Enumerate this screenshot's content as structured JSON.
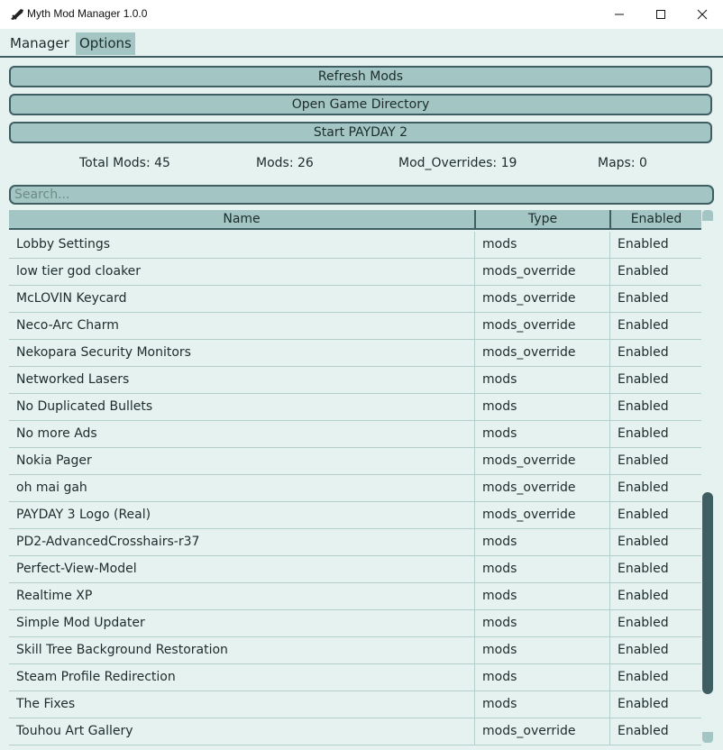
{
  "window": {
    "title": "Myth Mod Manager 1.0.0",
    "icons": {
      "app": "dagger-icon",
      "minimize": "minimize-icon",
      "maximize": "maximize-icon",
      "close": "close-icon"
    }
  },
  "menu": {
    "items": [
      {
        "label": "Manager"
      },
      {
        "label": "Options"
      }
    ],
    "active": "Options"
  },
  "actions": {
    "refresh": "Refresh Mods",
    "open_dir": "Open Game Directory",
    "start": "Start PAYDAY 2"
  },
  "stats": {
    "total": "Total Mods: 45",
    "mods": "Mods: 26",
    "overrides": "Mod_Overrides: 19",
    "maps": "Maps: 0"
  },
  "search": {
    "placeholder": "Search..."
  },
  "table": {
    "columns": [
      "Name",
      "Type",
      "Enabled"
    ],
    "rows": [
      [
        "Lobby Settings",
        "mods",
        "Enabled"
      ],
      [
        "low tier god cloaker",
        "mods_override",
        "Enabled"
      ],
      [
        "McLOVIN Keycard",
        "mods_override",
        "Enabled"
      ],
      [
        "Neco-Arc Charm",
        "mods_override",
        "Enabled"
      ],
      [
        "Nekopara Security Monitors",
        "mods_override",
        "Enabled"
      ],
      [
        "Networked Lasers",
        "mods",
        "Enabled"
      ],
      [
        "No Duplicated Bullets",
        "mods",
        "Enabled"
      ],
      [
        "No more Ads",
        "mods",
        "Enabled"
      ],
      [
        "Nokia Pager",
        "mods_override",
        "Enabled"
      ],
      [
        "oh mai gah",
        "mods_override",
        "Enabled"
      ],
      [
        "PAYDAY 3 Logo (Real)",
        "mods_override",
        "Enabled"
      ],
      [
        "PD2-AdvancedCrosshairs-r37",
        "mods",
        "Enabled"
      ],
      [
        "Perfect-View-Model",
        "mods",
        "Enabled"
      ],
      [
        "Realtime XP",
        "mods",
        "Enabled"
      ],
      [
        "Simple Mod Updater",
        "mods",
        "Enabled"
      ],
      [
        "Skill Tree Background Restoration",
        "mods",
        "Enabled"
      ],
      [
        "Steam Profile Redirection",
        "mods",
        "Enabled"
      ],
      [
        "The Fixes",
        "mods",
        "Enabled"
      ],
      [
        "Touhou Art Gallery",
        "mods_override",
        "Enabled"
      ]
    ]
  },
  "colors": {
    "background": "#e6f2f0",
    "button": "#a3c6c4",
    "border": "#3e5e62",
    "text": "#1c2b2b"
  }
}
